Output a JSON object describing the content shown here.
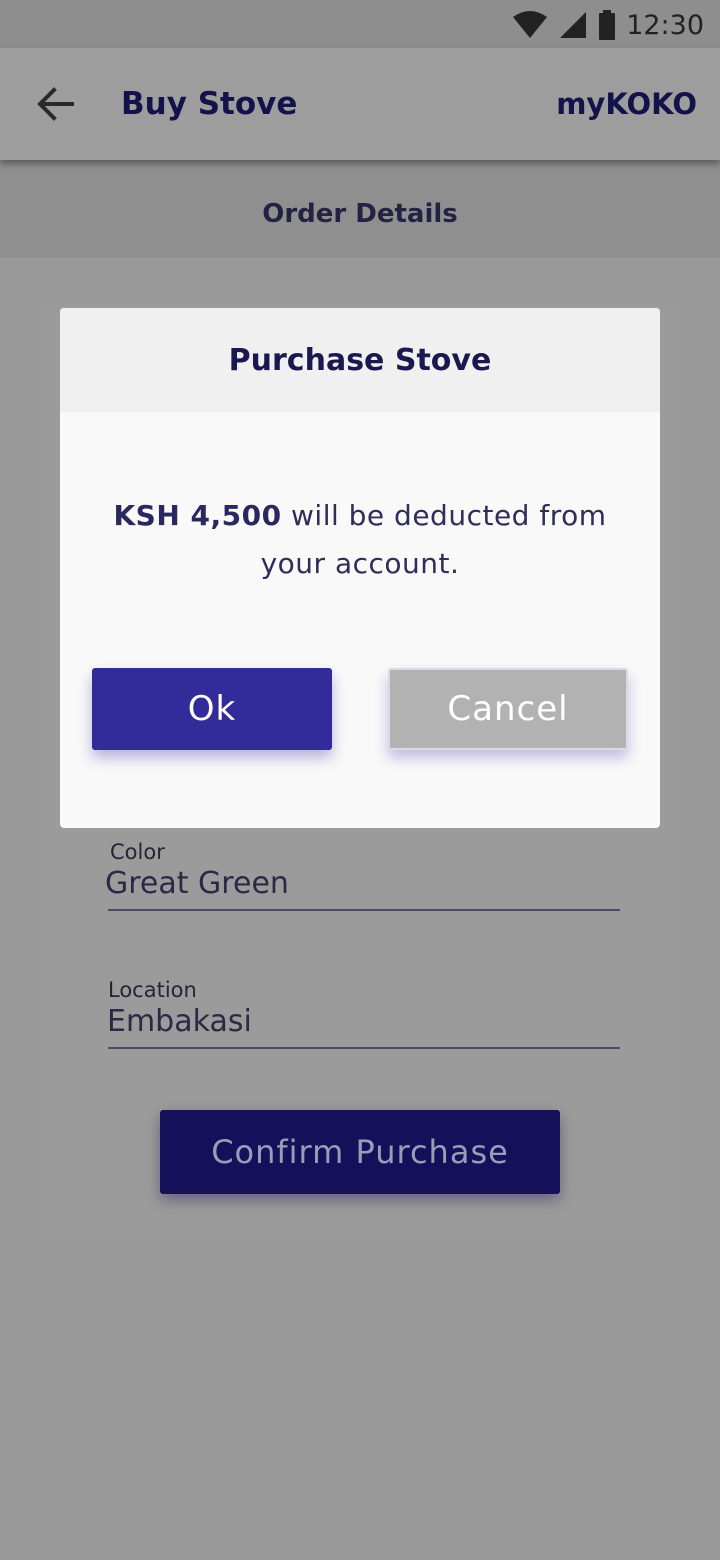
{
  "status_bar": {
    "time": "12:30",
    "icons": [
      "wifi-icon",
      "signal-icon",
      "battery-icon"
    ]
  },
  "app_bar": {
    "back_icon": "back-arrow-icon",
    "title": "Buy Stove",
    "brand": "myKOKO"
  },
  "section_header": {
    "title": "Order Details"
  },
  "form": {
    "color": {
      "label": "Color",
      "value": "Great Green"
    },
    "location": {
      "label": "Location",
      "value": "Embakasi"
    },
    "confirm_label": "Confirm Purchase"
  },
  "dialog": {
    "title": "Purchase Stove",
    "amount": "KSH 4,500",
    "message_rest": " will be deducted from your account.",
    "ok_label": "Ok",
    "cancel_label": "Cancel"
  },
  "colors": {
    "primary": "#322c9a",
    "dark_primary": "#14105a",
    "text_dark": "#14124a",
    "cancel_gray": "#b2b2b2"
  }
}
